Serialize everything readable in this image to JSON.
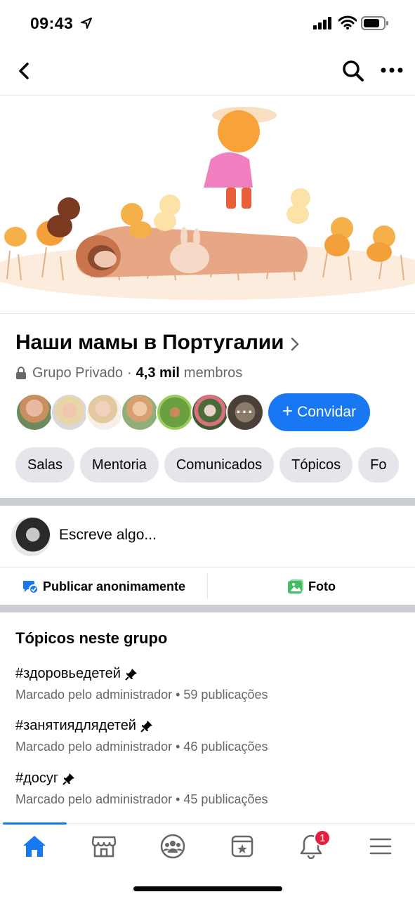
{
  "status_bar": {
    "time": "09:43"
  },
  "group": {
    "name": "Наши мамы в Португалии",
    "privacy": "Grupo Privado",
    "separator": "·",
    "member_count": "4,3 mil",
    "members_label": "membros",
    "invite_label": "Convidar",
    "more_members": "···"
  },
  "chips": [
    "Salas",
    "Mentoria",
    "Comunicados",
    "Tópicos",
    "Fo"
  ],
  "composer": {
    "placeholder": "Escreve algo..."
  },
  "post_actions": {
    "anonymous_label": "Publicar anonimamente",
    "photo_label": "Foto"
  },
  "topics": {
    "title": "Tópicos neste grupo",
    "items": [
      {
        "name": "#здоровьедетей",
        "meta": "Marcado pelo administrador • 59 publicações"
      },
      {
        "name": "#занятиядлядетей",
        "meta": "Marcado pelo administrador • 46 publicações"
      },
      {
        "name": "#досуг",
        "meta": "Marcado pelo administrador • 45 publicações"
      }
    ]
  },
  "tab_bar": {
    "notifications_badge": "1"
  },
  "colors": {
    "accent": "#1877f2",
    "badge": "#e41e3f",
    "chip_bg": "#e4e6eb",
    "secondary_text": "#65676b"
  }
}
